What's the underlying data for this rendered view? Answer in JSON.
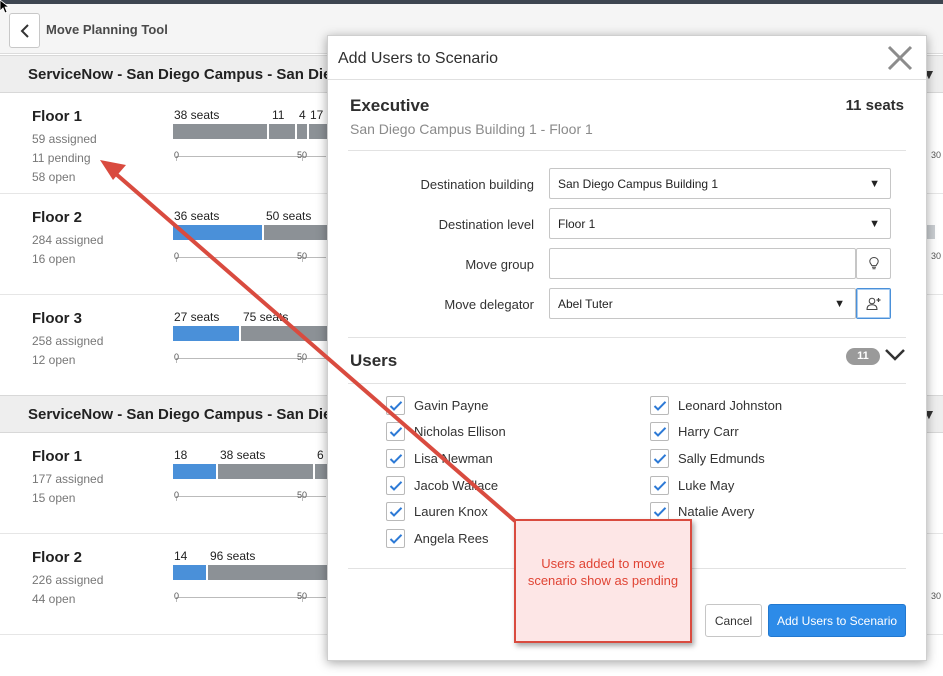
{
  "app": {
    "title": "Move Planning Tool"
  },
  "groups": [
    {
      "title": "ServiceNow - San Diego Campus - San Diego",
      "floors": [
        {
          "name": "Floor 1",
          "assigned": "59 assigned",
          "pending": "11 pending",
          "open": "58 open",
          "labels": [
            "38 seats",
            "11",
            "4",
            "17"
          ],
          "ticks": [
            "0",
            "50"
          ],
          "edge_tick": "30"
        },
        {
          "name": "Floor 2",
          "assigned": "284 assigned",
          "open": "16 open",
          "labels": [
            "36 seats",
            "50 seats"
          ],
          "ticks": [
            "0",
            "50"
          ],
          "edge_tick": "30"
        },
        {
          "name": "Floor 3",
          "assigned": "258 assigned",
          "open": "12 open",
          "labels": [
            "27 seats",
            "75 seats"
          ],
          "ticks": [
            "0",
            "50"
          ],
          "edge_tick": ""
        }
      ]
    },
    {
      "title": "ServiceNow - San Diego Campus - San Diego",
      "floors": [
        {
          "name": "Floor 1",
          "assigned": "177 assigned",
          "open": "15 open",
          "labels": [
            "18",
            "38 seats",
            "6"
          ],
          "ticks": [
            "0",
            "50"
          ],
          "edge_tick": ""
        },
        {
          "name": "Floor 2",
          "assigned": "226 assigned",
          "open": "44 open",
          "labels": [
            "14",
            "96 seats"
          ],
          "ticks": [
            "0",
            "50"
          ],
          "edge_tick": "30"
        }
      ]
    }
  ],
  "modal": {
    "title": "Add Users to Scenario",
    "close_icon": "close-icon",
    "scenario_title": "Executive",
    "seats": "11 seats",
    "location": "San Diego Campus Building 1 - Floor 1",
    "form": {
      "destination_building_label": "Destination building",
      "destination_building_value": "San Diego Campus Building 1",
      "destination_level_label": "Destination level",
      "destination_level_value": "Floor 1",
      "move_group_label": "Move group",
      "move_group_value": "",
      "move_delegator_label": "Move delegator",
      "move_delegator_value": "Abel Tuter"
    },
    "users_title": "Users",
    "users_count": "11",
    "users_left": [
      "Gavin Payne",
      "Nicholas Ellison",
      "Lisa Newman",
      "Jacob Wallace",
      "Lauren Knox",
      "Angela Rees"
    ],
    "users_right": [
      "Leonard Johnston",
      "Harry Carr",
      "Sally Edmunds",
      "Luke May",
      "Natalie Avery"
    ],
    "cancel_label": "Cancel",
    "add_label": "Add Users to Scenario"
  },
  "annotation": {
    "text": "Users added to move scenario show as pending"
  },
  "colors": {
    "accent_blue": "#4a90d9",
    "button_blue": "#2d8be8",
    "bar_grey": "#8c9196",
    "annotation_red": "#d94b3f"
  }
}
